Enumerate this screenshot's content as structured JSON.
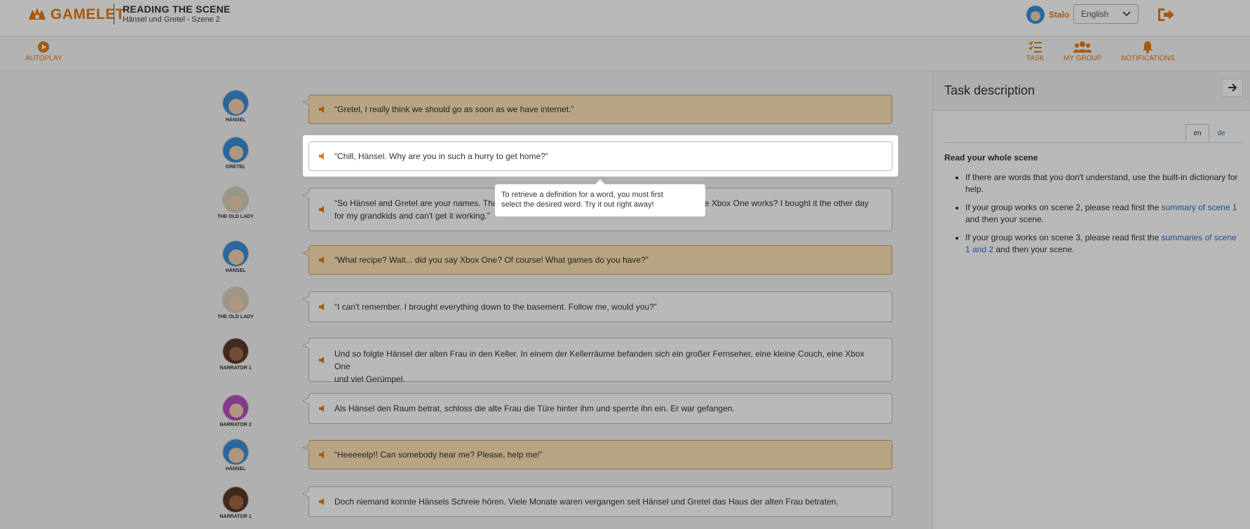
{
  "header": {
    "logo_text": "GAMELET",
    "title": "READING THE SCENE",
    "subtitle": "Hänsel und Gretel - Szene 2",
    "user_name": "Stalo",
    "language": "English"
  },
  "toolbar": {
    "autoplay": "AUTOPLAY",
    "task": "TASK",
    "my_group": "MY GROUP",
    "notifications": "NOTIFICATIONS"
  },
  "dialog": [
    {
      "speaker": "HÄNSEL",
      "text": "“Gretel, I really think we should go as soon as we have internet.”",
      "highlight": true,
      "face": "#3b8fd9"
    },
    {
      "speaker": "GRETEL",
      "text": "“Chill, Hänsel. Why are you in such a hurry to get home?”",
      "highlight": false,
      "face": "#3b8fd9"
    },
    {
      "speaker": "THE OLD LADY",
      "text": "“So Hänsel and Gretel are your names. That",
      "text_b": "the Xbox One works? I bought it the other day",
      "text_c": "for my grandkids and can't get it working.”",
      "highlight": false,
      "face": "#d8d0b8"
    },
    {
      "speaker": "HÄNSEL",
      "text": "“What recipe? Wait... did you say Xbox One? Of course! What games do you have?”",
      "highlight": true,
      "face": "#3b8fd9"
    },
    {
      "speaker": "THE OLD LADY",
      "text": "“I can't remember. I brought everything down to the basement. Follow me, would you?”",
      "highlight": false,
      "face": "#d8d0b8"
    },
    {
      "speaker": "NARRATOR 1",
      "text": "Und so folgte Hänsel der alten Frau in den Keller. In einem der Kellerräume befanden sich ein großer Fernseher, eine kleine Couch, eine Xbox One",
      "text_b": "und viel Gerümpel.",
      "highlight": false,
      "face": "#5a3a2a"
    },
    {
      "speaker": "NARRATOR 2",
      "text": "Als Hänsel den Raum betrat, schloss die alte Frau die Türe hinter ihm und sperrte ihn ein. Er war gefangen.",
      "highlight": false,
      "face": "#b84fc4"
    },
    {
      "speaker": "HÄNSEL",
      "text": "“Heeeeelp!! Can somebody hear me? Please, help me!”",
      "highlight": true,
      "face": "#3b8fd9"
    },
    {
      "speaker": "NARRATOR 1",
      "text": "Doch niemand konnte Hänsels Schreie hören. Viele Monate waren vergangen seit Hänsel und Gretel das Haus der alten Frau betraten.",
      "highlight": false,
      "face": "#5a3a2a"
    }
  ],
  "tooltip": {
    "line1": "To retrieve a definition for a word, you must first",
    "line2": "select the desired word. Try it out right away!"
  },
  "panel": {
    "title": "Task description",
    "lang_en": "en",
    "lang_de": "de",
    "heading": "Read your whole scene",
    "b1": "If there are words that you don't understand, use the built-in dictionary for help.",
    "b2_pre": "If your group works on scene 2, please read first the ",
    "b2_link": "summary of scene 1",
    "b2_post": " and then your scene.",
    "b3_pre": "If your group works on scene 3, please read first the ",
    "b3_link": "summaries of scene 1 and 2",
    "b3_post": " and then your scene."
  },
  "colors": {
    "accent": "#e87a13",
    "highlight": "#fde3b4",
    "link": "#2a6ebd"
  }
}
